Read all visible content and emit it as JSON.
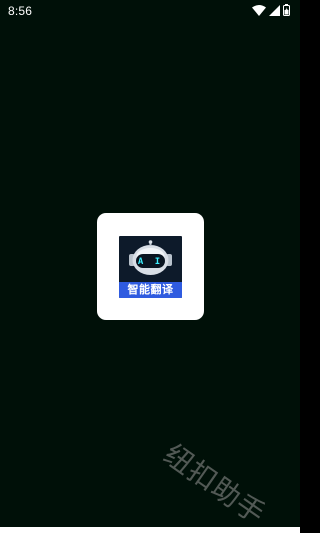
{
  "status_bar": {
    "time": "8:56",
    "icons": [
      "wifi-icon",
      "cellular-signal-icon",
      "battery-icon"
    ]
  },
  "splash": {
    "logo_ai_text": "A I",
    "logo_title": "智能翻译"
  },
  "watermark": {
    "text": "纽扣助手"
  },
  "colors": {
    "background": "#001008",
    "tile": "#ffffff",
    "logo_band": "#2f5be0",
    "logo_bg": "#0d1a2a",
    "accent": "#3ef0ff"
  }
}
